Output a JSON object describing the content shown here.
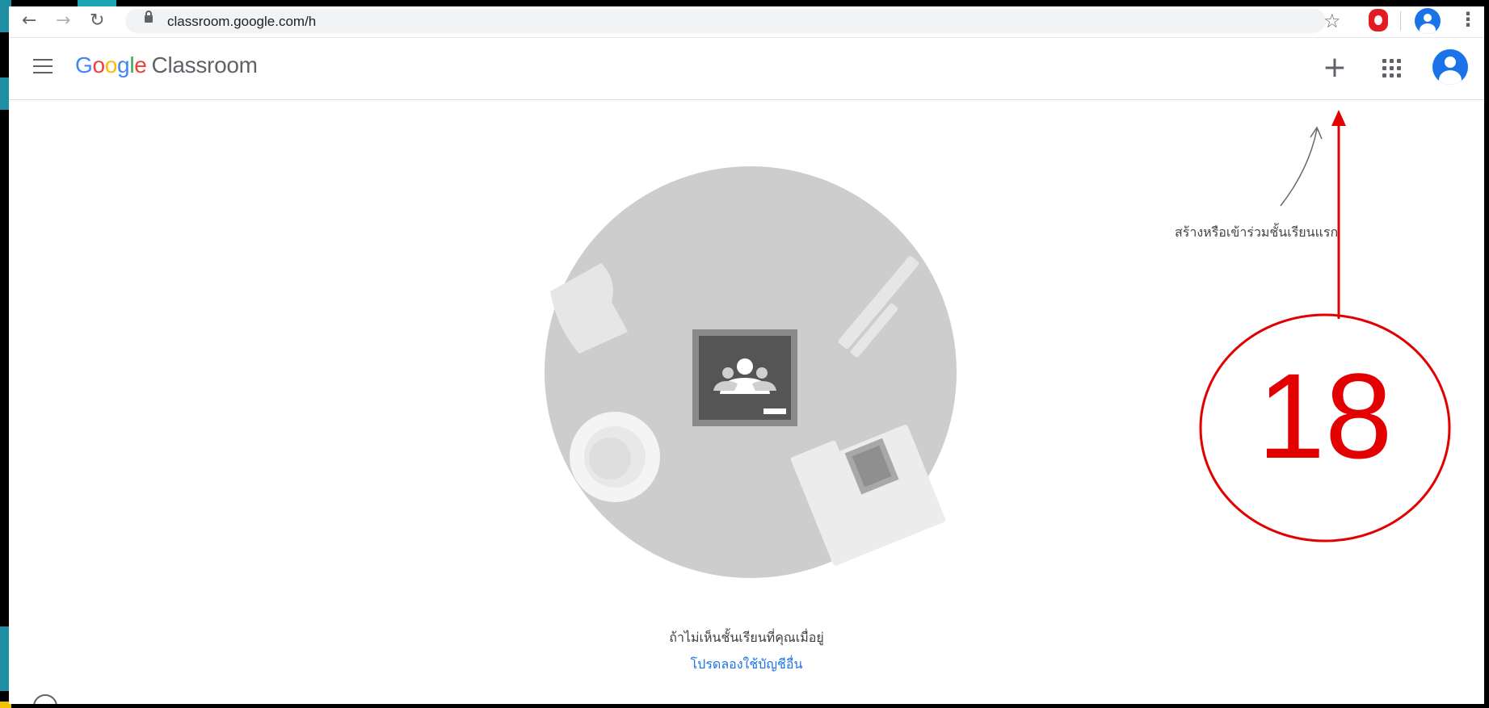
{
  "browser": {
    "url": "classroom.google.com/h",
    "back_icon": "arrow-left-icon",
    "forward_icon": "arrow-right-icon",
    "reload_icon": "reload-icon"
  },
  "app": {
    "brand_google": [
      "G",
      "o",
      "o",
      "g",
      "l",
      "e"
    ],
    "brand_product": "Classroom"
  },
  "empty_state": {
    "message": "ถ้าไม่เห็นชั้นเรียนที่คุณเมื่อยู่",
    "link": "โปรดลองใช้บัญชีอื่น",
    "hint": "สร้างหรือเข้าร่วมชั้นเรียนแรก"
  },
  "annotation": {
    "step": "18",
    "color": "#e30000"
  },
  "colors": {
    "google_blue": "#4285f4",
    "google_red": "#ea4335",
    "google_yellow": "#fbbc05",
    "google_green": "#34a853",
    "link": "#1a73e8"
  }
}
